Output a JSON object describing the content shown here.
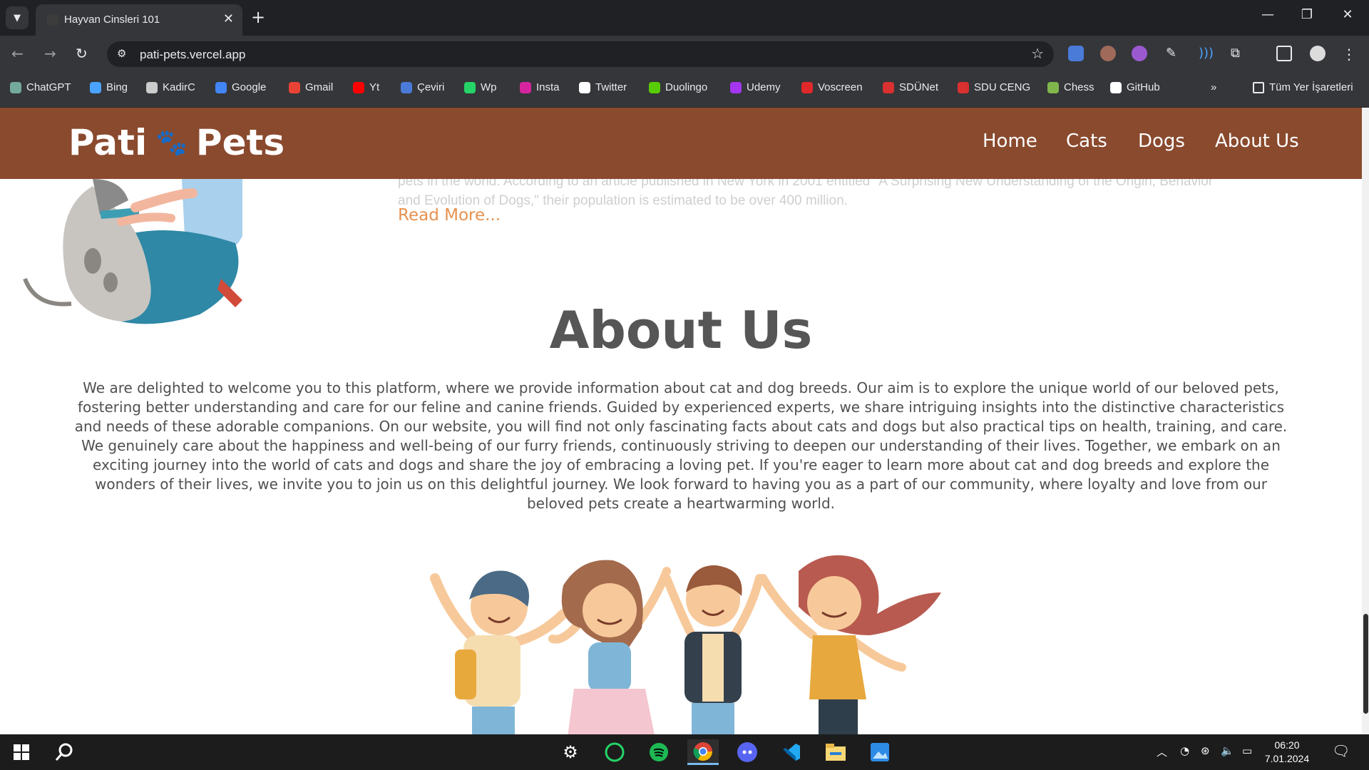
{
  "browser": {
    "tab_title": "Hayvan Cinsleri 101",
    "url": "pati-pets.vercel.app",
    "bookmarks": [
      {
        "label": "ChatGPT",
        "icon": "chatgpt-icon",
        "color": "#74aa9c"
      },
      {
        "label": "Bing",
        "icon": "bing-search-icon",
        "color": "#4aa3ff"
      },
      {
        "label": "KadirC",
        "icon": "kadirc-icon",
        "color": "#cccccc"
      },
      {
        "label": "Google",
        "icon": "google-icon",
        "color": "#4285f4"
      },
      {
        "label": "Gmail",
        "icon": "gmail-icon",
        "color": "#ea4335"
      },
      {
        "label": "Yt",
        "icon": "youtube-icon",
        "color": "#ff0000"
      },
      {
        "label": "Çeviri",
        "icon": "translate-icon",
        "color": "#4a7bd8"
      },
      {
        "label": "Wp",
        "icon": "whatsapp-icon",
        "color": "#25d366"
      },
      {
        "label": "Insta",
        "icon": "instagram-icon",
        "color": "#d6249f"
      },
      {
        "label": "Twitter",
        "icon": "x-icon",
        "color": "#ffffff"
      },
      {
        "label": "Duolingo",
        "icon": "duolingo-icon",
        "color": "#58cc02"
      },
      {
        "label": "Udemy",
        "icon": "udemy-icon",
        "color": "#a435f0"
      },
      {
        "label": "Voscreen",
        "icon": "voscreen-icon",
        "color": "#e0282b"
      },
      {
        "label": "SDÜNet",
        "icon": "sdunet-icon",
        "color": "#d93030"
      },
      {
        "label": "SDU CENG",
        "icon": "sdu-ceng-icon",
        "color": "#d93030"
      },
      {
        "label": "Chess",
        "icon": "chess-icon",
        "color": "#81b64c"
      },
      {
        "label": "GitHub",
        "icon": "github-icon",
        "color": "#ffffff"
      }
    ],
    "all_bookmarks_label": "Tüm Yer İşaretleri"
  },
  "site": {
    "logo_left": "Pati",
    "logo_right": "Pets",
    "nav": [
      "Home",
      "Cats",
      "Dogs",
      "About Us"
    ],
    "dogs_excerpt_line1": "pets in the world. According to an article published in New York in 2001 entitled \"A Surprising New Understanding of the Origin, Behavior",
    "dogs_excerpt_line2": "and Evolution of Dogs,\" their population is estimated to be over 400 million.",
    "read_more": "Read More...",
    "about_title": "About Us",
    "about_text": "We are delighted to welcome you to this platform, where we provide information about cat and dog breeds. Our aim is to explore the unique world of our beloved pets, fostering better understanding and care for our feline and canine friends. Guided by experienced experts, we share intriguing insights into the distinctive characteristics and needs of these adorable companions. On our website, you will find not only fascinating facts about cats and dogs but also practical tips on health, training, and care. We genuinely care about the happiness and well-being of our furry friends, continuously striving to deepen our understanding of their lives. Together, we embark on an exciting journey into the world of cats and dogs and share the joy of embracing a loving pet. If you're eager to learn more about cat and dog breeds and explore the wonders of their lives, we invite you to join us on this delightful journey. We look forward to having you as a part of our community, where loyalty and love from our beloved pets create a heartwarming world."
  },
  "taskbar": {
    "time": "06:20",
    "date": "7.01.2024"
  }
}
